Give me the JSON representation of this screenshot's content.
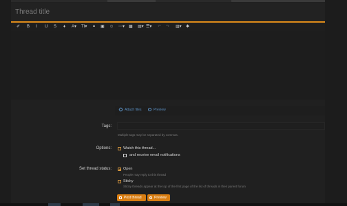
{
  "thread": {
    "title_placeholder": "Thread title"
  },
  "toolbar": {
    "buttons": [
      {
        "name": "eraser-icon",
        "glyph": "✐"
      },
      {
        "name": "bold-button",
        "glyph": "B"
      },
      {
        "name": "italic-button",
        "glyph": "I"
      },
      {
        "name": "underline-button",
        "glyph": "U"
      },
      {
        "name": "strikethrough-button",
        "glyph": "S"
      },
      {
        "name": "color-icon",
        "glyph": "♦"
      },
      {
        "name": "font-family-button",
        "glyph": "A▾"
      },
      {
        "name": "font-size-button",
        "glyph": "TI▾"
      },
      {
        "name": "link-icon",
        "glyph": "⚭"
      },
      {
        "name": "image-icon",
        "glyph": "▣"
      },
      {
        "name": "emoji-icon",
        "glyph": "☺"
      },
      {
        "name": "more-icon",
        "glyph": "⋯▾"
      },
      {
        "name": "media-icon",
        "glyph": "▩"
      },
      {
        "name": "paragraph-button",
        "glyph": "▤▾"
      },
      {
        "name": "list-button",
        "glyph": "☰▾"
      },
      {
        "name": "undo-icon",
        "glyph": "↶"
      },
      {
        "name": "redo-icon",
        "glyph": "↷"
      },
      {
        "name": "insert-button",
        "glyph": "▥▾"
      },
      {
        "name": "settings-icon",
        "glyph": "✱"
      }
    ]
  },
  "attachments": {
    "attach_label": "Attach files",
    "preview_label": "Preview"
  },
  "tags": {
    "label": "Tags:",
    "hint": "Multiple tags may be separated by commas."
  },
  "options": {
    "label": "Options:",
    "watch": "Watch this thread...",
    "email": "and receive email notifications"
  },
  "status": {
    "label": "Set thread status:",
    "open": "Open",
    "open_hint": "People may reply to this thread",
    "sticky": "Sticky",
    "sticky_hint": "Sticky threads appear at the top of the first page of the list of threads in their parent forum"
  },
  "actions": {
    "post": "Post thread",
    "preview": "Preview"
  },
  "colors": {
    "accent": "#e08c1a",
    "button": "#d97e12",
    "link": "#5b8fc2"
  }
}
